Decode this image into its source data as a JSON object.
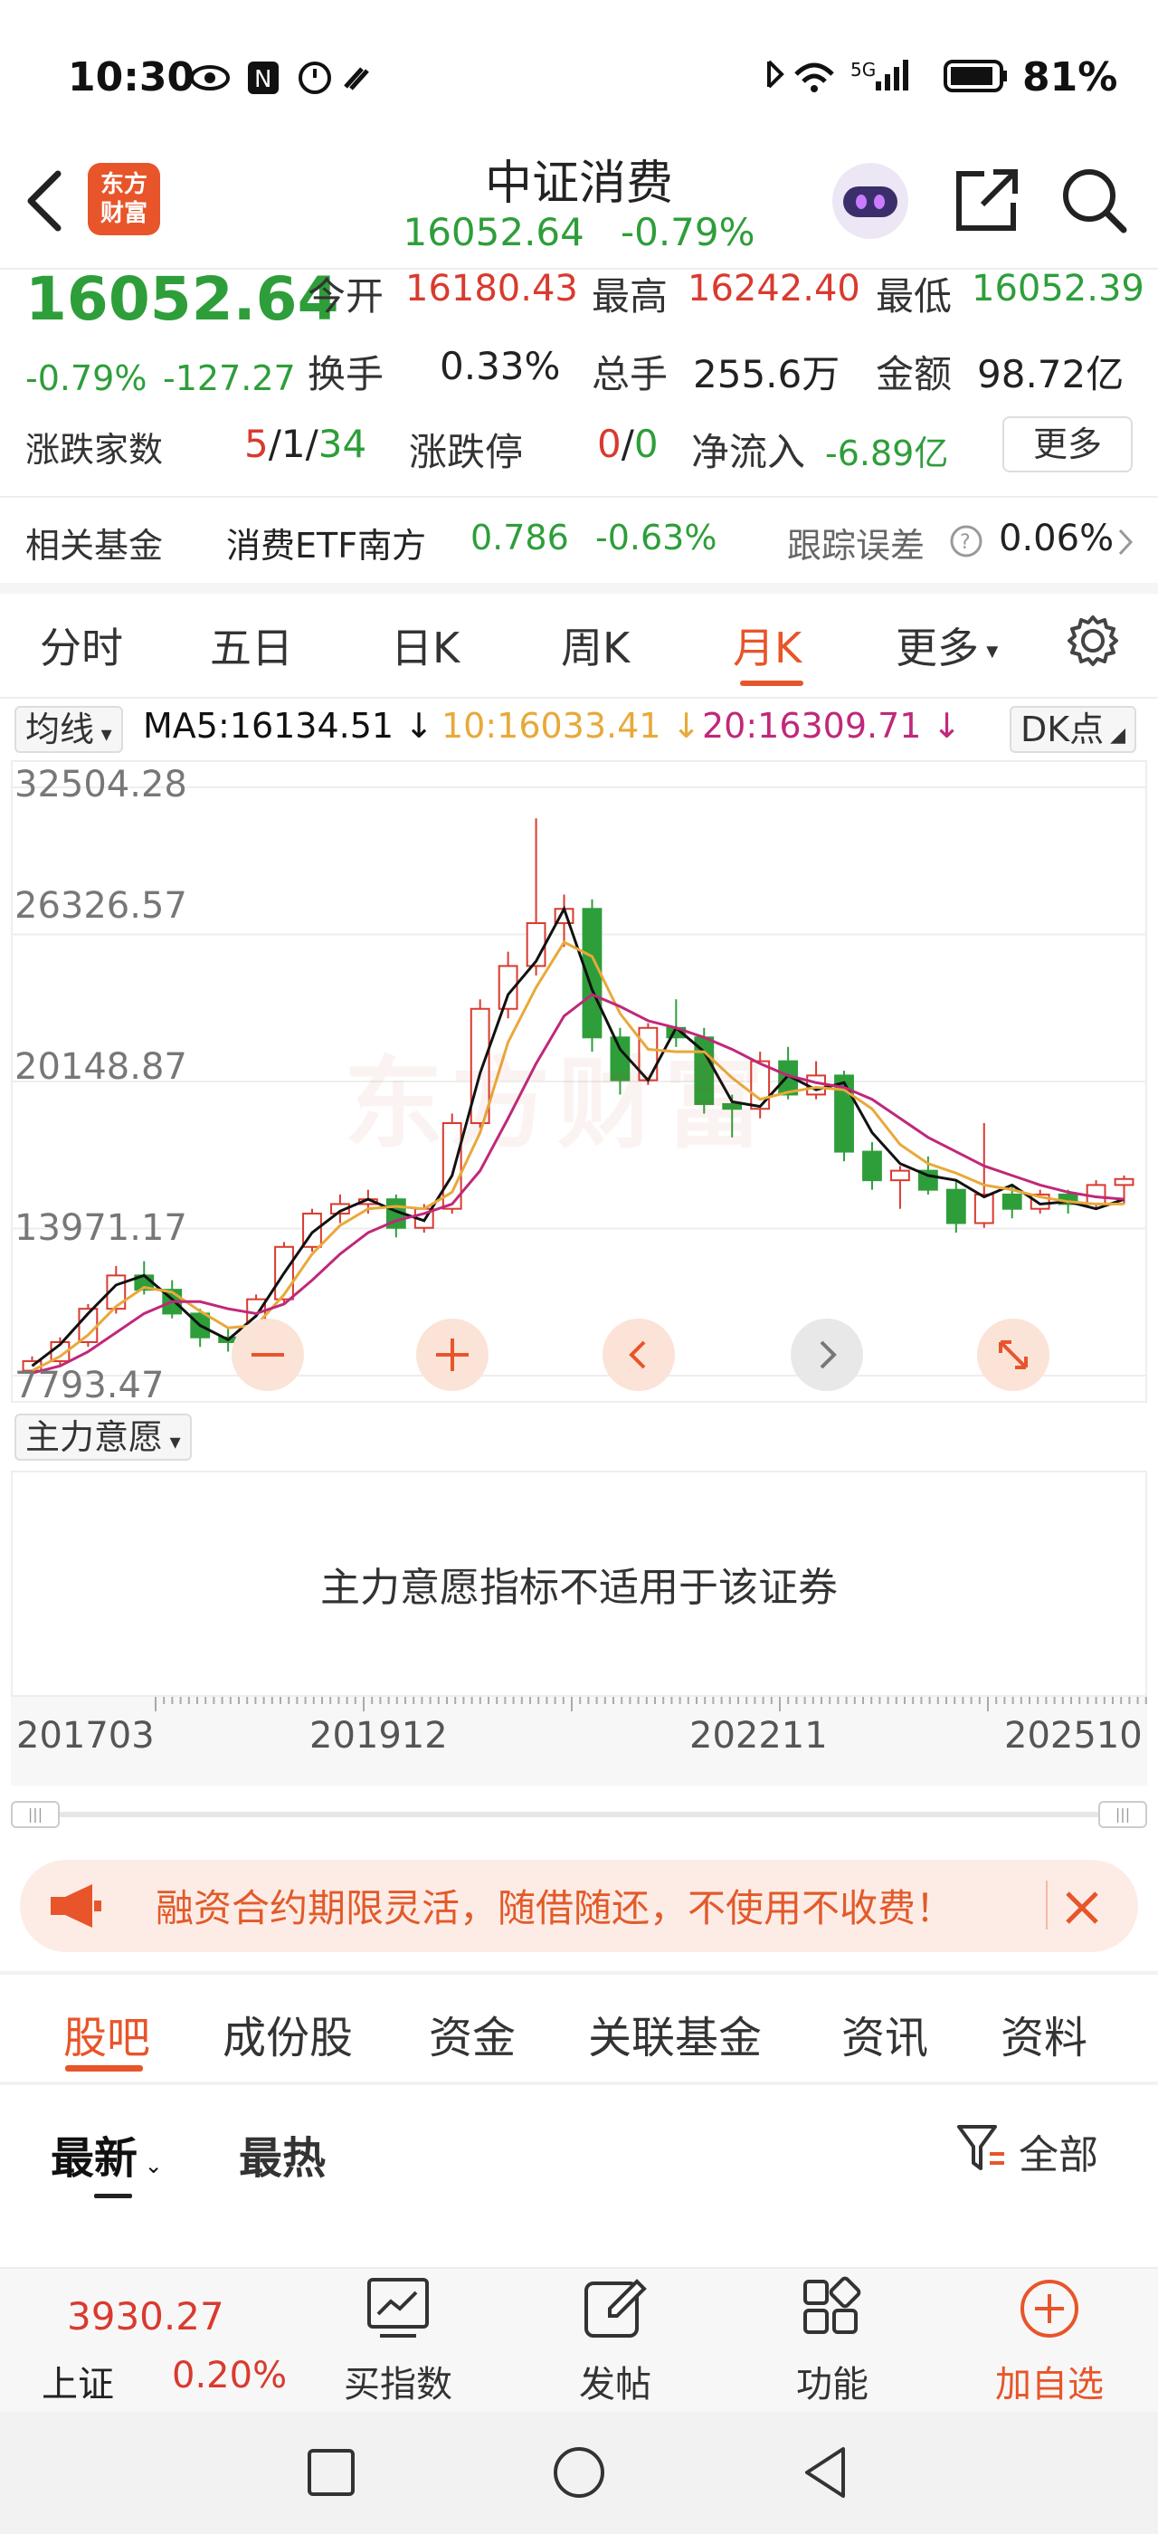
{
  "status_bar": {
    "time": "10:30",
    "battery": "81%",
    "network": "5G"
  },
  "nav": {
    "logo_line1": "东方",
    "logo_line2": "财富",
    "title": "中证消费",
    "price": "16052.64",
    "change_pct": "-0.79%"
  },
  "quote": {
    "price": "16052.64",
    "change_pct": "-0.79%",
    "change_abs": "-127.27",
    "open_label": "今开",
    "open": "16180.43",
    "high_label": "最高",
    "high": "16242.40",
    "low_label": "最低",
    "low": "16052.39",
    "turnover_label": "换手",
    "turnover": "0.33%",
    "volume_label": "总手",
    "volume": "255.6万",
    "amount_label": "金额",
    "amount": "98.72亿",
    "updown_label": "涨跌家数",
    "up": "5",
    "flat": "1",
    "down": "34",
    "limit_label": "涨跌停",
    "limit_up": "0",
    "limit_down": "0",
    "netflow_label": "净流入",
    "netflow": "-6.89亿",
    "more": "更多"
  },
  "fund": {
    "label": "相关基金",
    "name": "消费ETF南方",
    "price": "0.786",
    "change": "-0.63%",
    "tracking_label": "跟踪误差",
    "tracking": "0.06%"
  },
  "period_tabs": {
    "t1": "分时",
    "t2": "五日",
    "t3": "日K",
    "t4": "周K",
    "t5": "月K",
    "t6": "更多",
    "active": "月K"
  },
  "ma": {
    "selector": "均线",
    "ma5": "MA5:16134.51",
    "ma10": "10:16033.41",
    "ma20": "20:16309.71",
    "dk": "DK点",
    "color_ma5": "#111111",
    "color_ma10": "#e8a93a",
    "color_ma20": "#c0287a"
  },
  "chart_data": {
    "type": "candlestick",
    "y_ticks": [
      "32504.28",
      "26326.57",
      "20148.87",
      "13971.17",
      "7793.47"
    ],
    "ylim": [
      7793.47,
      32504.28
    ],
    "x_ticks": [
      "201703",
      "201912",
      "202211",
      "202510"
    ],
    "watermark": "东方财富",
    "series": [
      {
        "name": "MA5",
        "values": [
          8200,
          9100,
          10400,
          11600,
          12000,
          11000,
          9900,
          9300,
          10300,
          12100,
          13800,
          14700,
          15200,
          14700,
          14300,
          16200,
          20500,
          23800,
          25200,
          27400,
          24000,
          21500,
          20200,
          22400,
          21400,
          19300,
          19100,
          20400,
          19800,
          20100,
          18000,
          16700,
          16200,
          16000,
          15300,
          15800,
          15000,
          15100,
          14800,
          15200
        ]
      },
      {
        "name": "MA10",
        "values": [
          8000,
          8600,
          9500,
          10700,
          11500,
          11300,
          10500,
          9800,
          9900,
          11200,
          12900,
          14100,
          14800,
          14900,
          14800,
          15500,
          18000,
          21800,
          24100,
          26000,
          25400,
          23000,
          21500,
          21400,
          21400,
          20300,
          19400,
          19700,
          19900,
          19800,
          19000,
          17500,
          16700,
          16300,
          15800,
          15600,
          15300,
          15100,
          15000,
          15000
        ]
      },
      {
        "name": "MA20",
        "values": [
          7900,
          8200,
          8800,
          9600,
          10400,
          10900,
          10900,
          10600,
          10400,
          10800,
          11800,
          12900,
          13800,
          14300,
          14600,
          15000,
          16400,
          18600,
          20900,
          22900,
          23800,
          23300,
          22700,
          22400,
          22000,
          21500,
          20900,
          20400,
          20100,
          19900,
          19400,
          18600,
          17800,
          17200,
          16600,
          16200,
          15800,
          15500,
          15300,
          15200
        ]
      }
    ],
    "ohlc": [
      [
        8000,
        8600,
        7800,
        8400
      ],
      [
        8400,
        9400,
        8200,
        9200
      ],
      [
        9200,
        10800,
        9000,
        10600
      ],
      [
        10600,
        12400,
        10400,
        12000
      ],
      [
        12000,
        12600,
        11200,
        11400
      ],
      [
        11400,
        11800,
        10200,
        10400
      ],
      [
        10400,
        10600,
        9000,
        9400
      ],
      [
        9400,
        9800,
        8800,
        9200
      ],
      [
        9200,
        11200,
        9000,
        11000
      ],
      [
        11000,
        13400,
        10800,
        13200
      ],
      [
        13200,
        14800,
        13000,
        14600
      ],
      [
        14600,
        15400,
        14200,
        15000
      ],
      [
        15000,
        15600,
        14600,
        15200
      ],
      [
        15200,
        15400,
        13600,
        14000
      ],
      [
        14000,
        15000,
        13800,
        14800
      ],
      [
        14800,
        18800,
        14600,
        18400
      ],
      [
        18400,
        23600,
        18200,
        23200
      ],
      [
        23200,
        25600,
        22800,
        25000
      ],
      [
        25000,
        31200,
        24600,
        26800
      ],
      [
        26800,
        28000,
        25800,
        27400
      ],
      [
        27400,
        27800,
        21400,
        22000
      ],
      [
        22000,
        22400,
        19600,
        20200
      ],
      [
        20200,
        22600,
        20000,
        22400
      ],
      [
        22400,
        23600,
        21600,
        22000
      ],
      [
        22000,
        22400,
        18800,
        19200
      ],
      [
        19200,
        19600,
        17800,
        19000
      ],
      [
        19000,
        21400,
        18600,
        21000
      ],
      [
        21000,
        21600,
        19400,
        19600
      ],
      [
        19600,
        21000,
        19400,
        20400
      ],
      [
        20400,
        20600,
        16800,
        17200
      ],
      [
        17200,
        17600,
        15600,
        16000
      ],
      [
        16000,
        16600,
        14800,
        16400
      ],
      [
        16400,
        17000,
        15400,
        15600
      ],
      [
        15600,
        16000,
        13800,
        14200
      ],
      [
        14200,
        18400,
        14000,
        15400
      ],
      [
        15400,
        15800,
        14400,
        14800
      ],
      [
        14800,
        15600,
        14600,
        15400
      ],
      [
        15400,
        15600,
        14600,
        15000
      ],
      [
        15000,
        16000,
        14800,
        15800
      ],
      [
        15800,
        16200,
        15000,
        16052
      ]
    ]
  },
  "indicator": {
    "selector": "主力意愿",
    "message": "主力意愿指标不适用于该证券"
  },
  "banner": {
    "text": "融资合约期限灵活，随借随还，不使用不收费！"
  },
  "sub_tabs": {
    "t1": "股吧",
    "t2": "成份股",
    "t3": "资金",
    "t4": "关联基金",
    "t5": "资讯",
    "t6": "资料"
  },
  "sort": {
    "latest": "最新",
    "hot": "最热",
    "filter": "全部"
  },
  "toolbar": {
    "index_price": "3930.27",
    "index_name": "上证",
    "index_change": "0.20%",
    "buy": "买指数",
    "post": "发帖",
    "func": "功能",
    "add": "加自选"
  }
}
